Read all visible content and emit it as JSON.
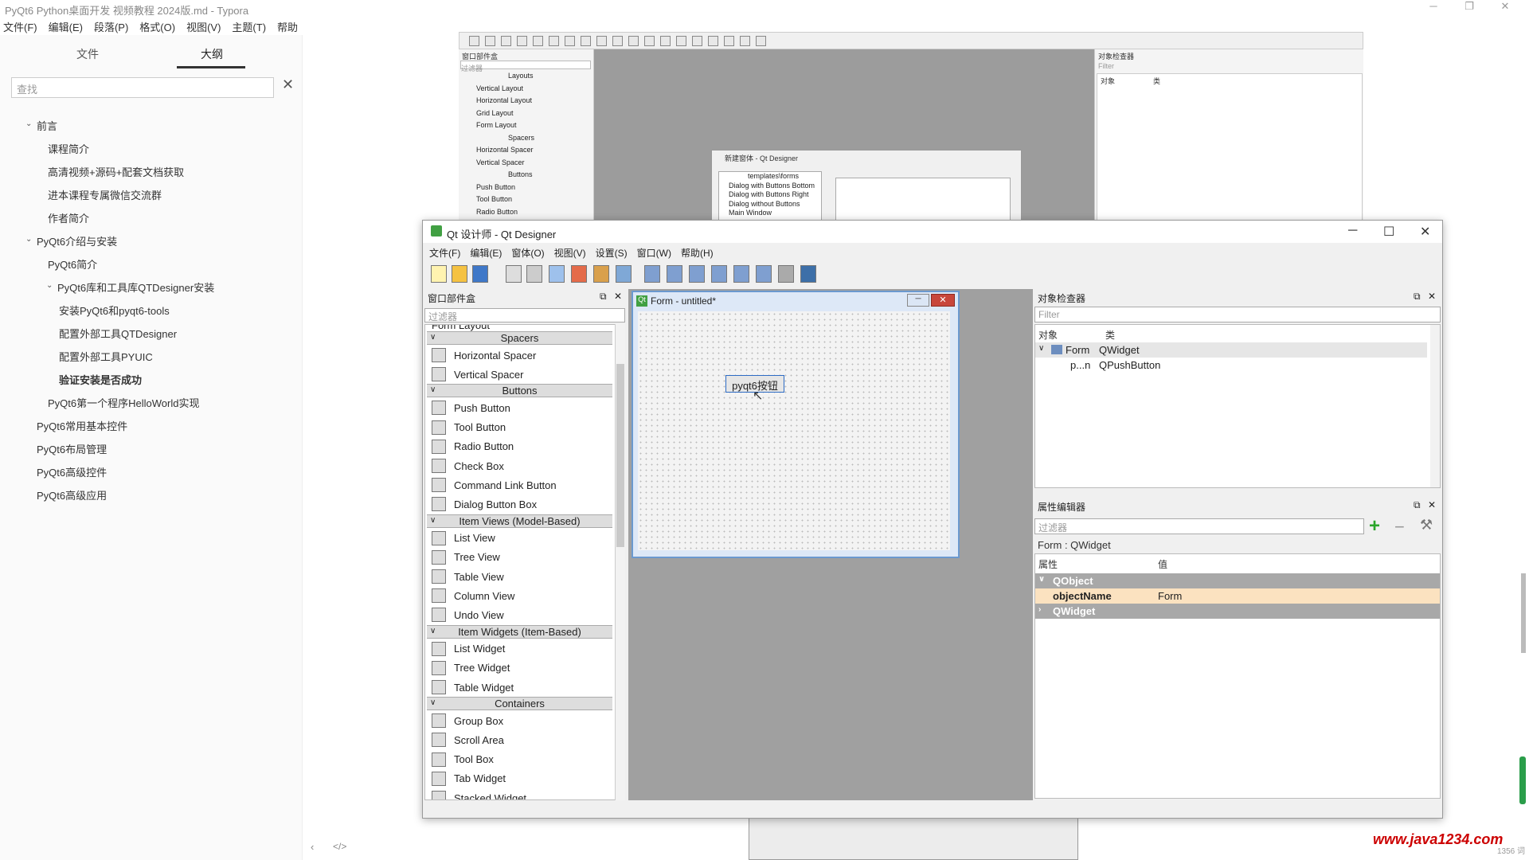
{
  "titlebar": {
    "title": "PyQt6 Python桌面开发 视频教程 2024版.md - Typora"
  },
  "menubar": {
    "items": [
      "文件(F)",
      "编辑(E)",
      "段落(P)",
      "格式(O)",
      "视图(V)",
      "主题(T)",
      "帮助(H)"
    ]
  },
  "sidebar": {
    "tab_files": "文件",
    "tab_outline": "大纲",
    "search_placeholder": "查找",
    "outline": [
      {
        "label": "前言",
        "level": 1,
        "expanded": true
      },
      {
        "label": "课程简介",
        "level": 2
      },
      {
        "label": "高清视频+源码+配套文档获取",
        "level": 2
      },
      {
        "label": "进本课程专属微信交流群",
        "level": 2
      },
      {
        "label": "作者简介",
        "level": 2
      },
      {
        "label": "PyQt6介绍与安装",
        "level": 1,
        "expanded": true
      },
      {
        "label": "PyQt6简介",
        "level": 2
      },
      {
        "label": "PyQt6库和工具库QTDesigner安装",
        "level": 2,
        "expanded": true
      },
      {
        "label": "安装PyQt6和pyqt6-tools",
        "level": 3
      },
      {
        "label": "配置外部工具QTDesigner",
        "level": 3
      },
      {
        "label": "配置外部工具PYUIC",
        "level": 3
      },
      {
        "label": "验证安装是否成功",
        "level": 3,
        "active": true
      },
      {
        "label": "PyQt6第一个程序HelloWorld实现",
        "level": 2
      },
      {
        "label": "PyQt6常用基本控件",
        "level": 1
      },
      {
        "label": "PyQt6布局管理",
        "level": 1
      },
      {
        "label": "PyQt6高级控件",
        "level": 1
      },
      {
        "label": "PyQt6高级应用",
        "level": 1
      }
    ]
  },
  "bg": {
    "widgetbox_title": "窗口部件盒",
    "filter": "过滤器",
    "items": [
      "Layouts",
      "Vertical Layout",
      "Horizontal Layout",
      "Grid Layout",
      "Form Layout",
      "Spacers",
      "Horizontal Spacer",
      "Vertical Spacer",
      "Buttons",
      "Push Button",
      "Tool Button",
      "Radio Button"
    ],
    "dialog_title": "新建窗体 - Qt Designer",
    "dialog_items": [
      "templates\\forms",
      "Dialog with Buttons Bottom",
      "Dialog with Buttons Right",
      "Dialog without Buttons",
      "Main Window"
    ],
    "inspector_title": "对象检查器",
    "inspector_filter": "Filter",
    "col_object": "对象",
    "col_class": "类"
  },
  "qd": {
    "title": "Qt 设计师 - Qt Designer",
    "menu": [
      "文件(F)",
      "编辑(E)",
      "窗体(O)",
      "视图(V)",
      "设置(S)",
      "窗口(W)",
      "帮助(H)"
    ],
    "widgetbox": {
      "title": "窗口部件盒",
      "filter": "过滤器",
      "partial": "Form Layout",
      "entries": [
        {
          "cat": "Spacers"
        },
        {
          "label": "Horizontal Spacer"
        },
        {
          "label": "Vertical Spacer"
        },
        {
          "cat": "Buttons"
        },
        {
          "label": "Push Button"
        },
        {
          "label": "Tool Button"
        },
        {
          "label": "Radio Button"
        },
        {
          "label": "Check Box"
        },
        {
          "label": "Command Link Button"
        },
        {
          "label": "Dialog Button Box"
        },
        {
          "cat": "Item Views (Model-Based)"
        },
        {
          "label": "List View"
        },
        {
          "label": "Tree View"
        },
        {
          "label": "Table View"
        },
        {
          "label": "Column View"
        },
        {
          "label": "Undo View"
        },
        {
          "cat": "Item Widgets (Item-Based)"
        },
        {
          "label": "List Widget"
        },
        {
          "label": "Tree Widget"
        },
        {
          "label": "Table Widget"
        },
        {
          "cat": "Containers"
        },
        {
          "label": "Group Box"
        },
        {
          "label": "Scroll Area"
        },
        {
          "label": "Tool Box"
        },
        {
          "label": "Tab Widget"
        },
        {
          "label": "Stacked Widget"
        }
      ]
    },
    "form": {
      "title": "Form - untitled*",
      "button_text": "pyqt6按钮"
    },
    "inspector": {
      "title": "对象检查器",
      "filter": "Filter",
      "col_object": "对象",
      "col_class": "类",
      "rows": [
        {
          "obj": "Form",
          "cls": "QWidget"
        },
        {
          "obj": "p...n",
          "cls": "QPushButton"
        }
      ]
    },
    "props": {
      "title": "属性编辑器",
      "filter": "过滤器",
      "context": "Form : QWidget",
      "col_prop": "属性",
      "col_val": "值",
      "group1": "QObject",
      "prop_name": "objectName",
      "prop_val": "Form",
      "group2": "QWidget"
    }
  },
  "watermark": "www.java1234.com",
  "status": "1356 词"
}
